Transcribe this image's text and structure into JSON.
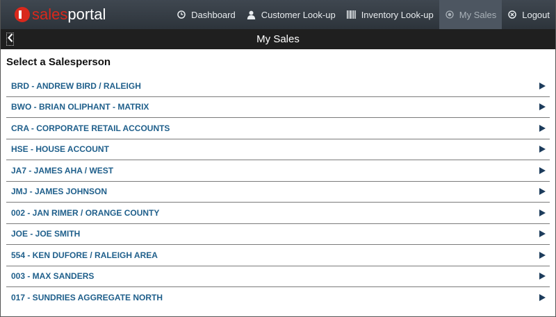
{
  "header": {
    "logo_prefix": "sales",
    "logo_suffix": "portal",
    "nav": [
      {
        "label": "Dashboard",
        "icon": "clock-icon"
      },
      {
        "label": "Customer Look-up",
        "icon": "person-icon"
      },
      {
        "label": "Inventory Look-up",
        "icon": "barcode-icon"
      },
      {
        "label": "My Sales",
        "icon": "target-icon",
        "active": true
      },
      {
        "label": "Logout",
        "icon": "close-circle-icon"
      }
    ]
  },
  "titlebar": {
    "title": "My Sales"
  },
  "main": {
    "heading": "Select a Salesperson",
    "salespeople": [
      "BRD - ANDREW BIRD / RALEIGH",
      "BWO - BRIAN OLIPHANT - MATRIX",
      "CRA - CORPORATE RETAIL ACCOUNTS",
      "HSE - HOUSE ACCOUNT",
      "JA7 - JAMES AHA / WEST",
      "JMJ - JAMES JOHNSON",
      "002 - JAN RIMER / ORANGE COUNTY",
      "JOE - JOE SMITH",
      "554 - KEN DUFORE / RALEIGH AREA",
      "003 - MAX SANDERS",
      "017 - SUNDRIES AGGREGATE NORTH"
    ]
  },
  "colors": {
    "accent": "#d9281c",
    "link": "#1f5f8b",
    "arrow": "#1d3c5c"
  }
}
